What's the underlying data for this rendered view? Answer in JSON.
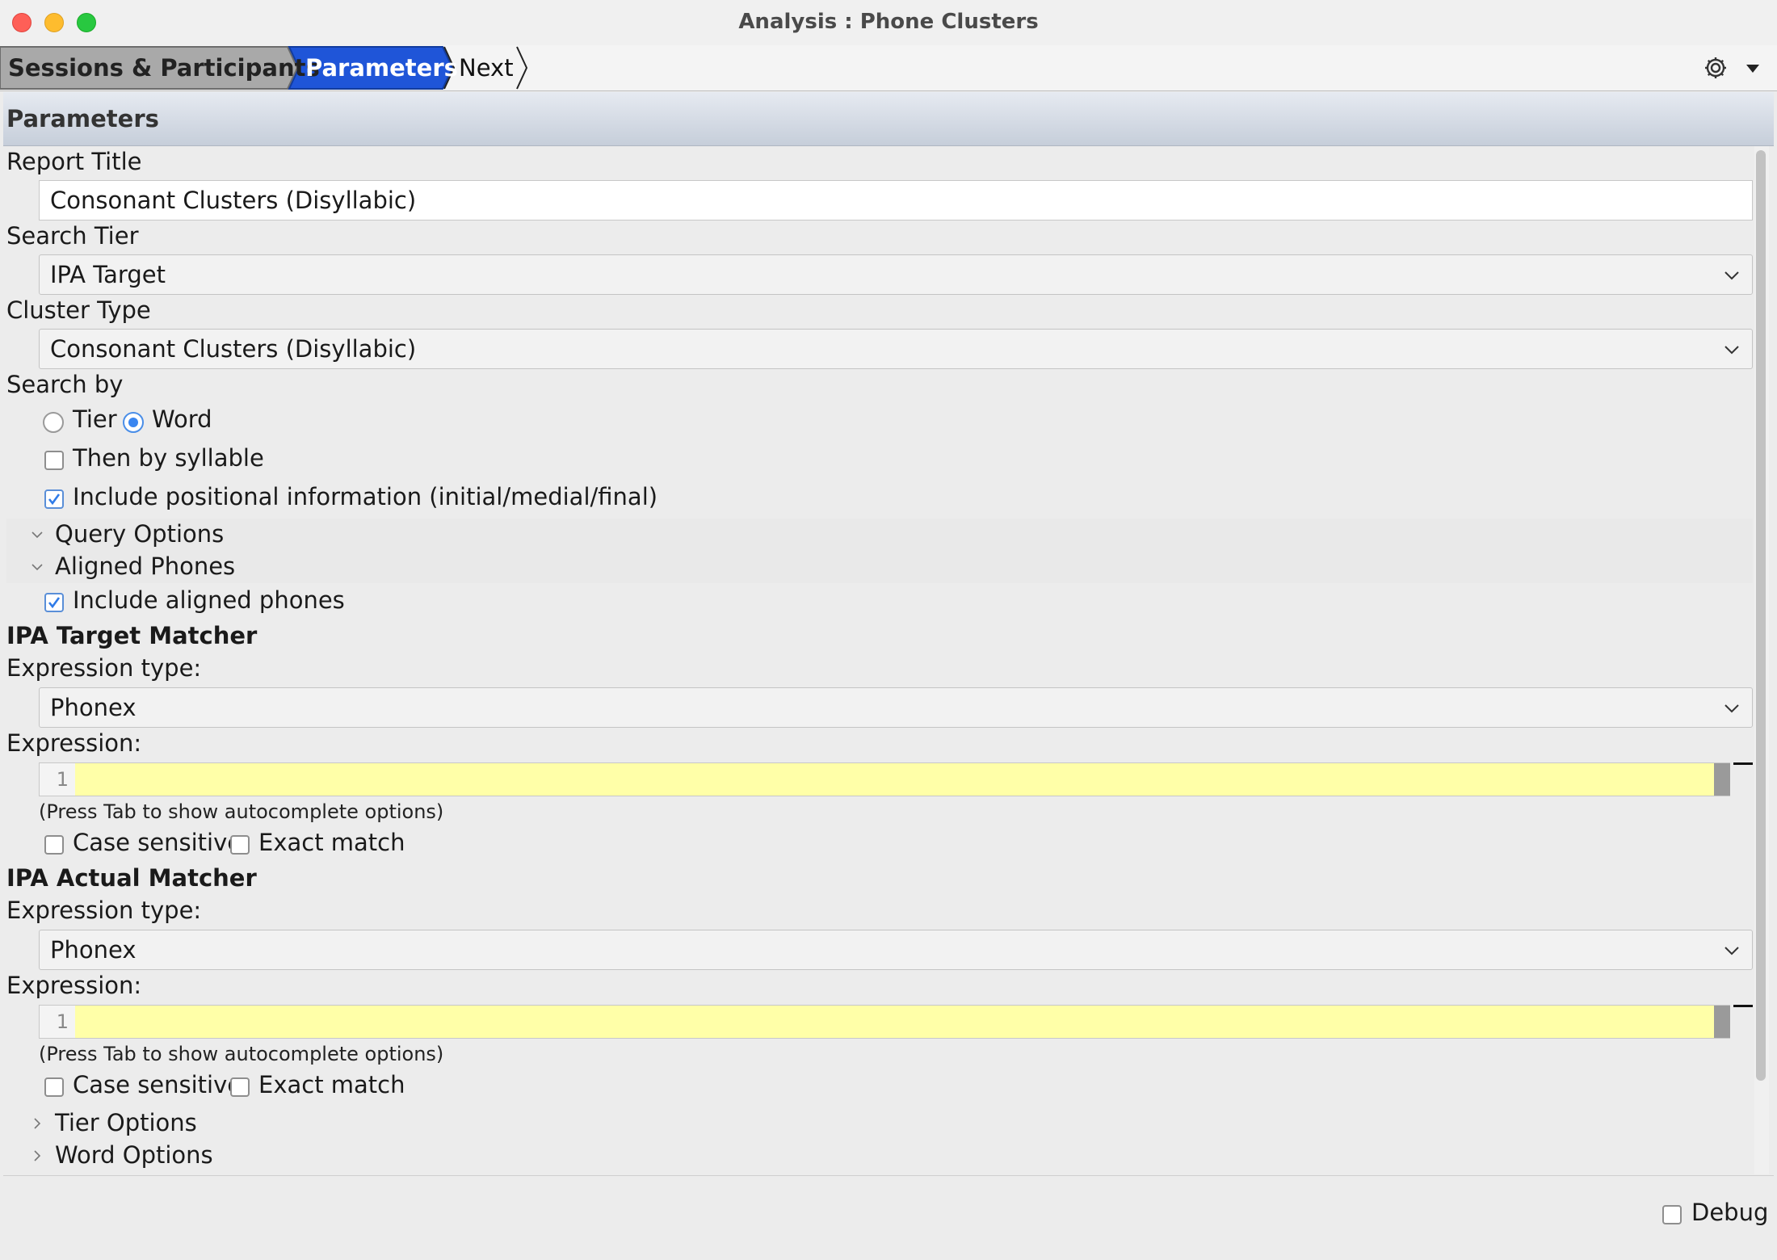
{
  "window": {
    "title": "Analysis : Phone Clusters"
  },
  "breadcrumb": {
    "items": [
      "Sessions & Participants",
      "Parameters",
      "Next"
    ]
  },
  "panel": {
    "title": "Parameters"
  },
  "form": {
    "report_title_label": "Report Title",
    "report_title_value": "Consonant Clusters (Disyllabic)",
    "search_tier_label": "Search Tier",
    "search_tier_value": "IPA Target",
    "cluster_type_label": "Cluster Type",
    "cluster_type_value": "Consonant Clusters (Disyllabic)",
    "search_by_label": "Search by",
    "search_by_options": [
      "Tier",
      "Word"
    ],
    "search_by_selected": "Word",
    "then_by_syllable": {
      "label": "Then by syllable",
      "checked": false
    },
    "include_positional": {
      "label": "Include positional information (initial/medial/final)",
      "checked": true
    },
    "query_options_label": "Query Options",
    "aligned_phones_label": "Aligned Phones",
    "include_aligned": {
      "label": "Include aligned phones",
      "checked": true
    }
  },
  "target_matcher": {
    "heading": "IPA Target Matcher",
    "expr_type_label": "Expression type:",
    "expr_type_value": "Phonex",
    "expr_label": "Expression:",
    "line_number": "1",
    "hint": "(Press Tab to show autocomplete options)",
    "case_sensitive": {
      "label": "Case sensitive",
      "checked": false
    },
    "exact_match": {
      "label": "Exact match",
      "checked": false
    }
  },
  "actual_matcher": {
    "heading": "IPA Actual Matcher",
    "expr_type_label": "Expression type:",
    "expr_type_value": "Phonex",
    "expr_label": "Expression:",
    "line_number": "1",
    "hint": "(Press Tab to show autocomplete options)",
    "case_sensitive": {
      "label": "Case sensitive",
      "checked": false
    },
    "exact_match": {
      "label": "Exact match",
      "checked": false
    }
  },
  "sections": {
    "tier_options": "Tier Options",
    "word_options": "Word Options"
  },
  "footer": {
    "debug": {
      "label": "Debug",
      "checked": false
    }
  },
  "colors": {
    "accent": "#1f55d8",
    "expression_bg": "#ffffa8",
    "checkbox_accent": "#2f7be8"
  }
}
